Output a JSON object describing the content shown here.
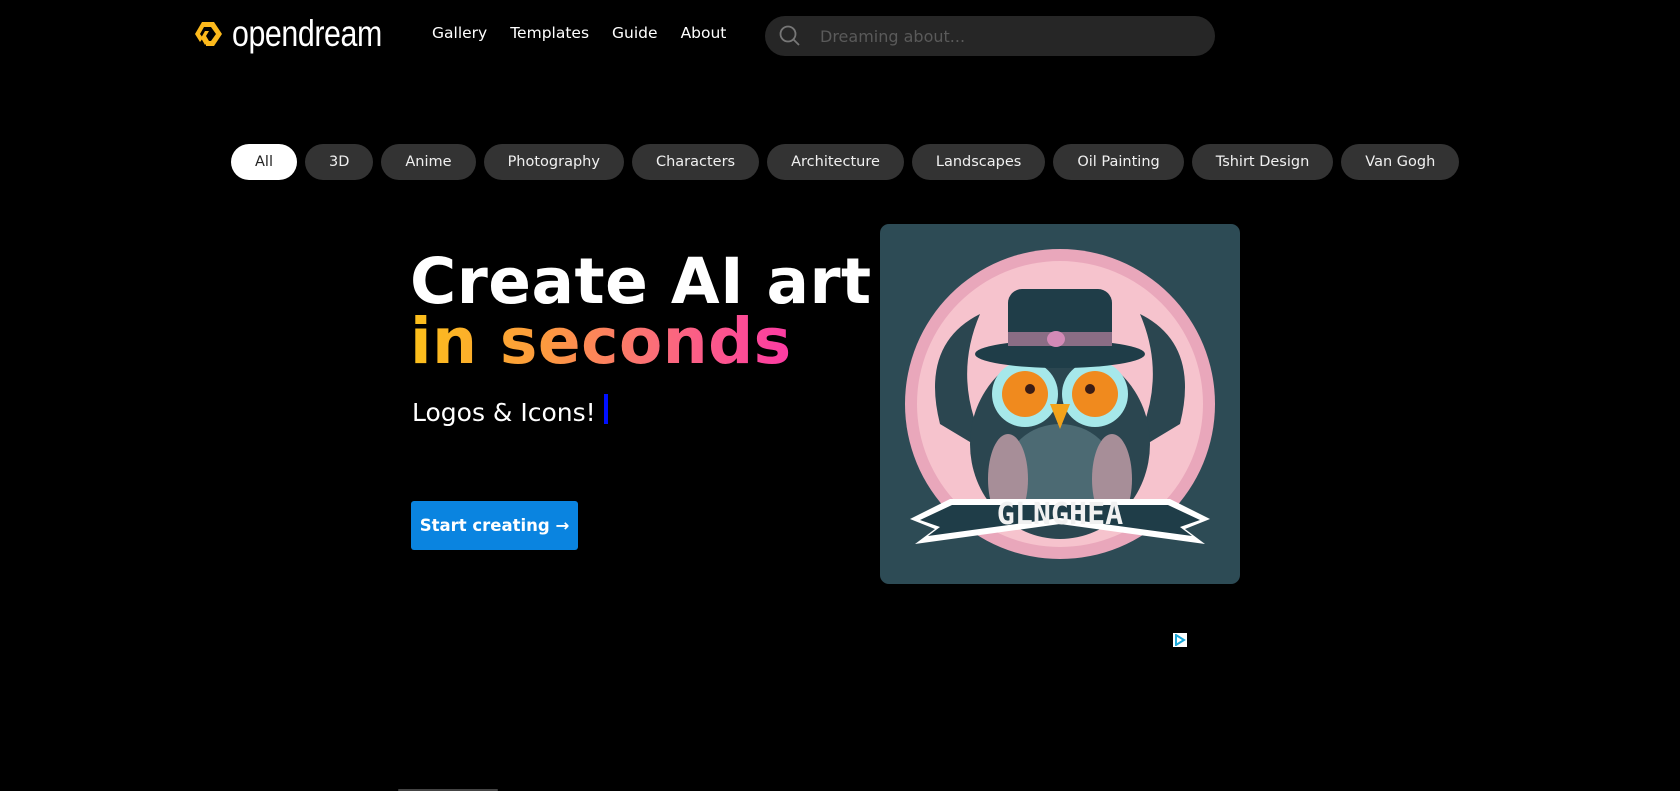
{
  "header": {
    "logo_text": "opendream",
    "brand_color": "#FCB91C",
    "nav": [
      {
        "label": "Gallery"
      },
      {
        "label": "Templates"
      },
      {
        "label": "Guide"
      },
      {
        "label": "About"
      }
    ],
    "search": {
      "placeholder": "Dreaming about...",
      "value": "",
      "icon": "search-icon"
    }
  },
  "categories": {
    "items": [
      {
        "label": "All",
        "active": true
      },
      {
        "label": "3D",
        "active": false
      },
      {
        "label": "Anime",
        "active": false
      },
      {
        "label": "Photography",
        "active": false
      },
      {
        "label": "Characters",
        "active": false
      },
      {
        "label": "Architecture",
        "active": false
      },
      {
        "label": "Landscapes",
        "active": false
      },
      {
        "label": "Oil Painting",
        "active": false
      },
      {
        "label": "Tshirt Design",
        "active": false
      },
      {
        "label": "Van Gogh",
        "active": false
      }
    ]
  },
  "hero": {
    "title_line1": "Create AI art",
    "title_line2": "in seconds",
    "subtitle": "Logos & Icons!",
    "cta_label": "Start creating →",
    "cta_color": "#0A84E0",
    "image": {
      "banner_text": "GLNGHEA",
      "alt": "owl logo illustration"
    }
  },
  "ad": {
    "icon": "adchoices-icon"
  }
}
